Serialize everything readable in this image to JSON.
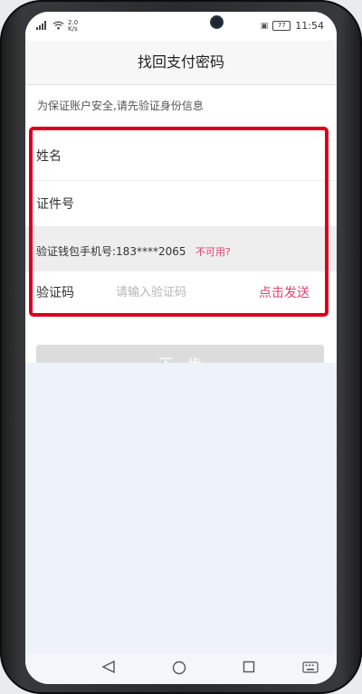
{
  "statusbar": {
    "network": "2.0\nK/s",
    "battery": "77",
    "time": "11:54"
  },
  "navbar": {
    "title": "找回支付密码"
  },
  "form": {
    "hint": "为保证账户安全,请先验证身份信息",
    "name_label": "姓名",
    "id_label": "证件号",
    "phone_text": "验证钱包手机号:183****2065",
    "unavailable_link": "不可用?",
    "code_label": "验证码",
    "code_placeholder": "请输入验证码",
    "send_code_label": "点击发送"
  },
  "next_button": {
    "label": "下一步"
  },
  "colors": {
    "accent": "#e0416f",
    "highlight_border": "#d8001e",
    "button_disabled": "#dcdcdc"
  },
  "icons": {
    "back": "triangle-left",
    "home": "circle",
    "recents": "square",
    "keyboard": "keyboard"
  }
}
